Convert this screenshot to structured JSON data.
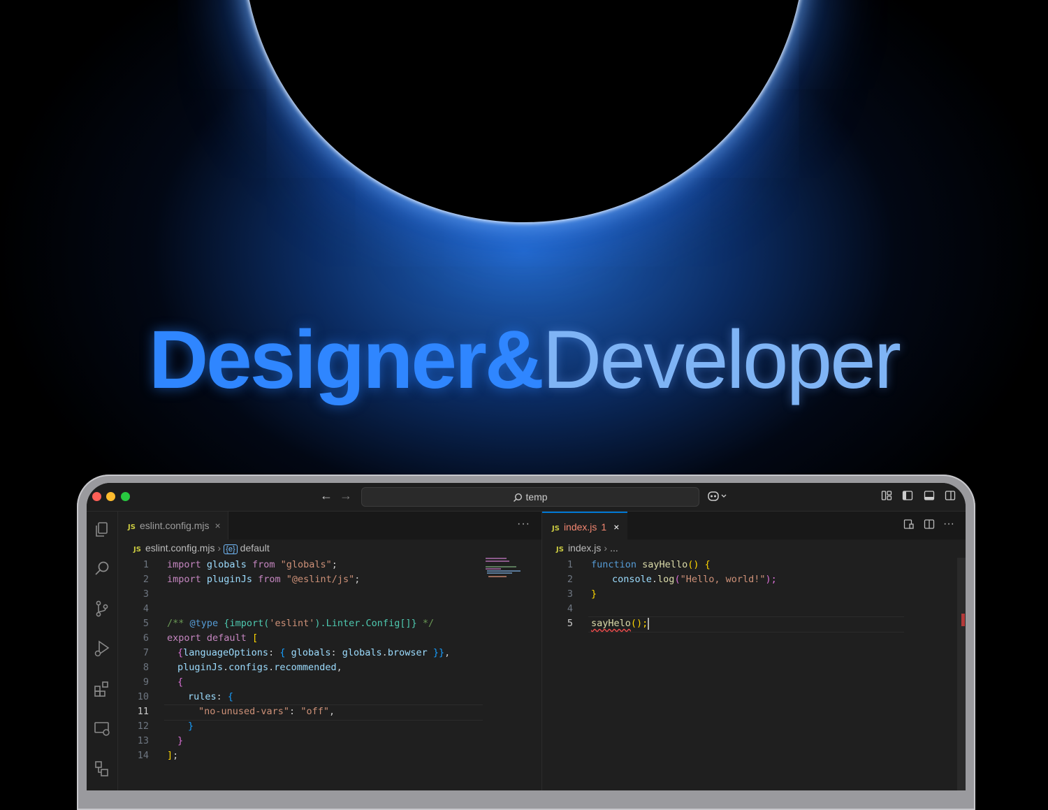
{
  "hero": {
    "headline_part1": "Designer&",
    "headline_part2": "Developer",
    "accent_color": "#2f86ff"
  },
  "titlebar": {
    "search_text": "temp",
    "back_icon": "arrow-left-icon",
    "forward_icon": "arrow-right-icon"
  },
  "activity_bar": [
    "explorer-icon",
    "search-icon",
    "source-control-icon",
    "run-debug-icon",
    "extensions-icon",
    "remote-explorer-icon",
    "testing-icon"
  ],
  "editor_left": {
    "tab": {
      "icon": "JS",
      "label": "eslint.config.mjs",
      "close": "×"
    },
    "more": "···",
    "breadcrumb": {
      "file": "eslint.config.mjs",
      "symbol_icon": "{e}",
      "symbol": "default"
    },
    "line_numbers": [
      "1",
      "2",
      "3",
      "4",
      "5",
      "6",
      "7",
      "8",
      "9",
      "10",
      "11",
      "12",
      "13",
      "14"
    ],
    "active_line": "11",
    "code": {
      "l1_kw": "import",
      "l1_var": "globals",
      "l1_from": "from",
      "l1_str": "\"globals\"",
      "l1_end": ";",
      "l2_kw": "import",
      "l2_var": "pluginJs",
      "l2_from": "from",
      "l2_str": "\"@eslint/js\"",
      "l2_end": ";",
      "l5_c1": "/** ",
      "l5_tag": "@type",
      "l5_b1": "{",
      "l5_fn": "import",
      "l5_p1": "(",
      "l5_str": "'eslint'",
      "l5_p2": ")",
      "l5_type": ".Linter.Config[]",
      "l5_b2": "}",
      "l5_c2": " */",
      "l6_kw": "export default",
      "l6_br": "[",
      "l7_br": "{",
      "l7_key": "languageOptions",
      "l7_p": ": ",
      "l7_b2": "{",
      "l7_k2": " globals",
      "l7_p2": ": ",
      "l7_v": "globals",
      "l7_dot": ".",
      "l7_v2": "browser",
      "l7_e": " }}",
      "l7_c": ",",
      "l8_v": "pluginJs",
      "l8_d1": ".",
      "l8_v2": "configs",
      "l8_d2": ".",
      "l8_v3": "recommended",
      "l8_c": ",",
      "l9_br": "{",
      "l10_key": "rules",
      "l10_p": ": ",
      "l10_br": "{",
      "l11_str": "\"no-unused-vars\"",
      "l11_p": ": ",
      "l11_str2": "\"off\"",
      "l11_c": ",",
      "l12_br": "}",
      "l13_br": "}",
      "l14_br": "]",
      "l14_end": ";"
    }
  },
  "editor_right": {
    "tab": {
      "icon": "JS",
      "label": "index.js",
      "problems": "1",
      "close": "×"
    },
    "breadcrumb": {
      "file": "index.js",
      "rest": "..."
    },
    "more": "···",
    "line_numbers": [
      "1",
      "2",
      "3",
      "4",
      "5"
    ],
    "active_line": "5",
    "code": {
      "l1_kw": "function",
      "l1_fn": "sayHello",
      "l1_p": "()",
      "l1_br": "{",
      "l2_v": "console",
      "l2_d": ".",
      "l2_fn": "log",
      "l2_p1": "(",
      "l2_str": "\"Hello, world!\"",
      "l2_p2": ");",
      "l3_br": "}",
      "l5_fn": "sayHelo",
      "l5_p": "();"
    }
  }
}
